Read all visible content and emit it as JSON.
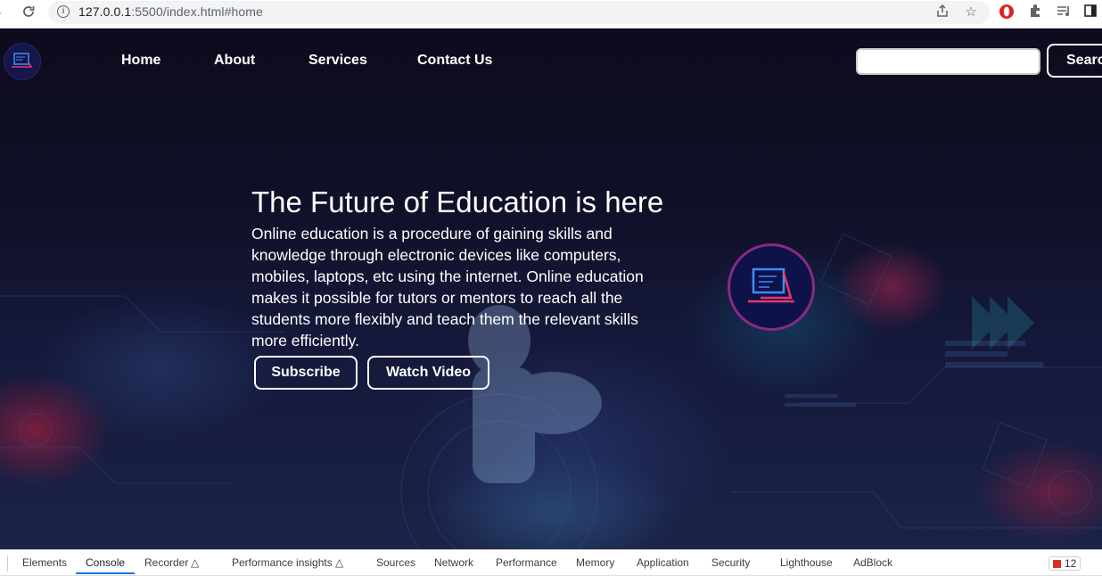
{
  "browser": {
    "url_host": "127.0.0.1",
    "url_rest": ":5500/index.html#home",
    "icons": [
      "forward-icon",
      "reload-icon",
      "info-icon",
      "share-icon",
      "star-icon",
      "opera-icon",
      "extensions-icon",
      "playlist-icon",
      "sidepanel-icon"
    ]
  },
  "header": {
    "nav": [
      {
        "label": "Home"
      },
      {
        "label": "About"
      },
      {
        "label": "Services"
      },
      {
        "label": "Contact Us"
      }
    ],
    "search_placeholder": "",
    "search_label": "Search"
  },
  "hero": {
    "title": "The Future of Education is here",
    "description": "Online education is a procedure of gaining skills and knowledge through electronic devices like computers, mobiles, laptops, etc using the internet. Online education makes it possible for tutors or mentors to reach all the students more flexibly and teach them the relevant skills more efficiently.",
    "subscribe_label": "Subscribe",
    "watch_label": "Watch Video"
  },
  "devtools": {
    "tabs": [
      "Elements",
      "Console",
      "Recorder",
      "Performance insights",
      "Sources",
      "Network",
      "Performance",
      "Memory",
      "Application",
      "Security",
      "Lighthouse",
      "AdBlock"
    ],
    "active_tab": "Console",
    "error_count": "12"
  },
  "colors": {
    "accent_blue": "#1a73e8",
    "hero_ring": "#8a2a82",
    "error_red": "#d93025"
  }
}
